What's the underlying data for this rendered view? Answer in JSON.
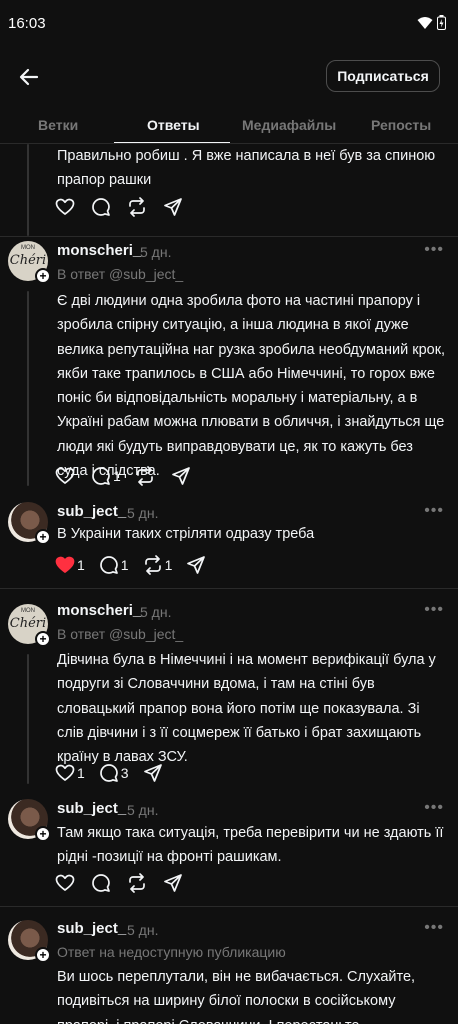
{
  "status_bar": {
    "time": "16:03"
  },
  "header": {
    "subscribe_label": "Подписаться"
  },
  "tabs": [
    "Ветки",
    "Ответы",
    "Медиафайлы",
    "Репосты"
  ],
  "posts": [
    {
      "text": "Правильно робиш . Я вже написала в неї був за спиною прапор рашки",
      "counts": {
        "like": "",
        "reply": "",
        "repost": ""
      }
    },
    {
      "username": "monscheri_",
      "time": "5 дн.",
      "reply_to": "В ответ @sub_ject_",
      "text": "Є дві людини одна зробила фото на частині прапору і зробила спірну ситуацію, а інша людина в якої дуже велика репутаційна наг рузка  зробила необдуманий крок, якби таке трапилось в США або Німеччині, то горох вже поніс би відповідальність моральну і матеріальну, а в Україні рабам можна плювати в обличчя, і знайдуться ще люди які будуть виправдовувати це, як то кажуть без суда і слідства.",
      "counts": {
        "like": "",
        "reply": "1",
        "repost": ""
      }
    },
    {
      "username": "sub_ject_",
      "time": "5 дн.",
      "text": "В Украіни таких стріляти одразу треба",
      "counts": {
        "like": "1",
        "reply": "1",
        "repost": "1"
      },
      "liked": true
    },
    {
      "username": "monscheri_",
      "time": "5 дн.",
      "reply_to": "В ответ @sub_ject_",
      "text": "Дівчина була в Німеччині і на момент верифікації була у подруги зі Словаччини вдома, і там на стіні був словацький прапор вона його потім ще показувала. Зі слів дівчини і з її соцмереж її батько і брат захищають країну в лавах ЗСУ.",
      "counts": {
        "like": "1",
        "reply": "3",
        "repost": ""
      }
    },
    {
      "username": "sub_ject_",
      "time": "5 дн.",
      "text": "Там якщо така ситуація, треба перевірити чи не здають її рідні -позиції на фронті рашикам.",
      "counts": {
        "like": "",
        "reply": "",
        "repost": ""
      }
    },
    {
      "username": "sub_ject_",
      "time": "5 дн.",
      "reply_to": "Ответ на недоступную публикацию",
      "text": "Ви шось переплутали, він не вибачається. Слухайте, подивіться на ширину білої полоски в сосійському прапорі, і прапорі Словаччини. І перестаньте"
    }
  ],
  "avatars": {
    "monscheri_": "Chéri",
    "monscheri_small": "MON"
  },
  "colors": {
    "background": "#101010",
    "secondary_text": "#777777",
    "like_red": "#ff3040",
    "divider": "#2a2a2a"
  },
  "icons": [
    "back-arrow-icon",
    "wifi-icon",
    "battery-icon",
    "heart-icon",
    "comment-icon",
    "repost-icon",
    "share-icon",
    "more-icon",
    "plus-icon"
  ]
}
